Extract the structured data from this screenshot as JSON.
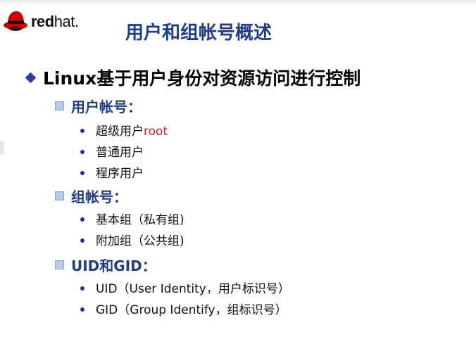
{
  "logo": {
    "brand_bold": "red",
    "brand_light": "hat."
  },
  "title": "用户和组帐号概述",
  "heading": "Linux基于用户身份对资源访问进行控制",
  "sections": [
    {
      "label": "用户帐号：",
      "items": [
        {
          "text": "超级用户",
          "highlight": "root"
        },
        {
          "text": "普通用户"
        },
        {
          "text": "程序用户"
        }
      ]
    },
    {
      "label": "组帐号：",
      "items": [
        {
          "text": "基本组（私有组)"
        },
        {
          "text": "附加组（公共组)"
        }
      ]
    },
    {
      "label": "UID和GID：",
      "items": [
        {
          "text": "UID（User Identity，用户标识号）"
        },
        {
          "text": "GID（Group Identify，组标识号）"
        }
      ]
    }
  ],
  "colors": {
    "title": "#1f3c88",
    "highlight": "#d42020",
    "bullet": "#2230a0"
  }
}
